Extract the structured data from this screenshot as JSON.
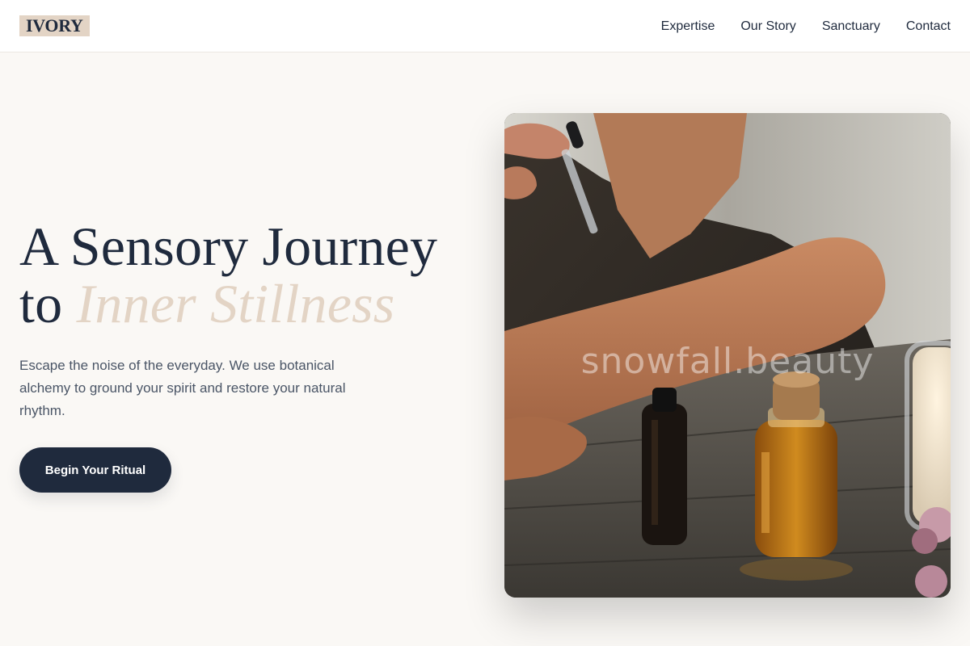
{
  "header": {
    "logo": "IVORY",
    "nav": [
      {
        "label": "Expertise"
      },
      {
        "label": "Our Story"
      },
      {
        "label": "Sanctuary"
      },
      {
        "label": "Contact"
      }
    ]
  },
  "hero": {
    "title_line1": "A Sensory Journey",
    "title_to": "to",
    "title_accent": "Inner Stillness",
    "subtitle": "Escape the noise of the everyday. We use botanical alchemy to ground your spirit and restore your natural rhythm.",
    "cta_label": "Begin Your Ritual"
  },
  "image": {
    "watermark": "snowfall.beauty"
  },
  "colors": {
    "navy": "#1f2a3d",
    "sand": "#e3d4c5",
    "background": "#faf8f5"
  }
}
